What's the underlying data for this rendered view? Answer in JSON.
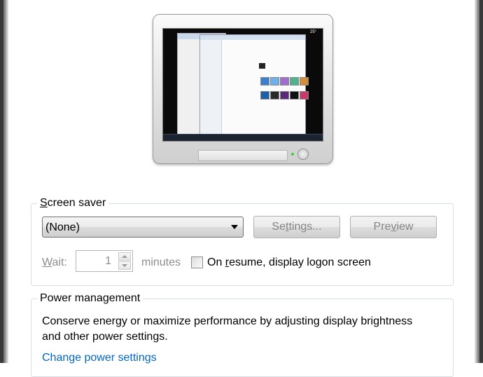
{
  "preview": {
    "gadget_text": "25°"
  },
  "screen_saver": {
    "group_title_prefix": "",
    "group_title_access": "S",
    "group_title_rest": "creen saver",
    "selected": "(None)",
    "settings_prefix": "Se",
    "settings_access": "t",
    "settings_rest": "tings...",
    "preview_prefix": "Pre",
    "preview_access": "v",
    "preview_rest": "iew",
    "wait_access": "W",
    "wait_rest": "ait:",
    "wait_value": "1",
    "minutes_label": "minutes",
    "resume_prefix": "On ",
    "resume_access": "r",
    "resume_rest": "esume, display logon screen"
  },
  "power": {
    "group_title": "Power management",
    "description": "Conserve energy or maximize performance by adjusting display brightness and other power settings.",
    "link": "Change power settings"
  },
  "colors": {
    "link": "#0066cc",
    "group_border": "#d5dfe5",
    "disabled_text": "#8d8d8d"
  }
}
